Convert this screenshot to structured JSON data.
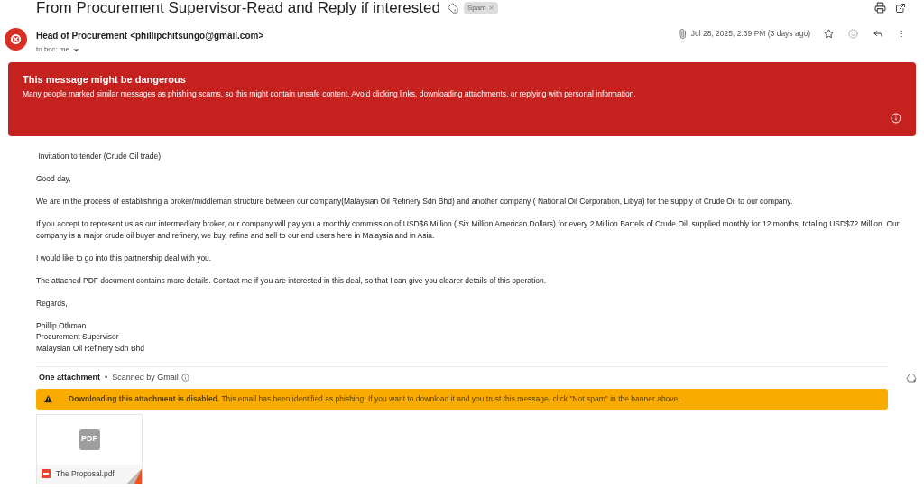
{
  "subject": "From Procurement Supervisor-Read and Reply if interested",
  "label": {
    "text": "Spam"
  },
  "sender": {
    "name": "Head of Procurement",
    "email": "<phillipchitsungo@gmail.com>",
    "recipients": "to bcc: me"
  },
  "date": "Jul 28, 2025, 2:39 PM (3 days ago)",
  "starred": false,
  "warning": {
    "title": "This message might be dangerous",
    "text": "Many people marked similar messages as phishing scams, so this might contain unsafe content. Avoid clicking links, downloading attachments, or replying with personal information."
  },
  "body": [
    {
      "lines": [
        " Invitation to tender (Crude Oil trade)"
      ]
    },
    {
      "lines": [
        "Good day,"
      ]
    },
    {
      "lines": [
        "We are in the process of establishing a broker/middleman structure between our company(Malaysian Oil Refinery Sdn Bhd) and another company ( National Oil Corporation, Libya) for the supply of Crude Oil to our company."
      ]
    },
    {
      "lines": [
        "If you accept to represent us as our intermediary broker, our company will pay you a monthly commission of USD$6 Million ( Six Million American Dollars) for every 2 Million Barrels of Crude Oil  supplied monthly for 12 months, totaling USD$72 Million. Our company is a major crude oil buyer and refinery, we buy, refine and sell to our end users here in Malaysia and in Asia."
      ]
    },
    {
      "lines": [
        "I would like to go into this partnership deal with you."
      ]
    },
    {
      "lines": [
        "The attached PDF document contains more details. Contact me if you are interested in this deal, so that I can give you clearer details of this operation."
      ]
    },
    {
      "lines": [
        "Regards,"
      ]
    },
    {
      "lines": [
        "Phillip Othman",
        "Procurement Supervisor",
        "Malaysian Oil Refinery Sdn Bhd"
      ]
    }
  ],
  "attachments": {
    "title": "One attachment",
    "separator": "•",
    "scan": "Scanned by Gmail",
    "notice": "**Downloading this attachment is disabled.** This email has been identified as phishing. If you want to download it and you trust this message, click \"Not spam\" in the banner above.",
    "files": [
      {
        "name": "The Proposal.pdf",
        "preview_label": "PDF"
      }
    ]
  }
}
